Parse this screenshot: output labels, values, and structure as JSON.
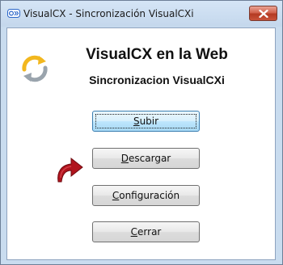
{
  "window": {
    "title": "VisualCX - Sincronización VisualCXi",
    "close_icon": "close-icon"
  },
  "content": {
    "heading": "VisualCX en la Web",
    "subheading": "Sincronizacion VisualCXi",
    "sync_icon": "sync-icon",
    "arrow_icon": "curved-arrow-icon"
  },
  "buttons": [
    {
      "access_key": "S",
      "rest": "ubir",
      "full": "Subir",
      "focused": true
    },
    {
      "access_key": "D",
      "rest": "escargar",
      "full": "Descargar",
      "focused": false
    },
    {
      "access_key": "C",
      "rest": "onfiguración",
      "full": "Configuración",
      "focused": false
    },
    {
      "access_key": "C",
      "rest": "errar",
      "full": "Cerrar",
      "focused": false
    }
  ],
  "colors": {
    "frame": "#c9dcef",
    "close_button": "#c9533a",
    "focused_button": "#bee6fd",
    "sync_icon_yellow": "#f2b71e",
    "sync_icon_gray": "#9aa4ad",
    "arrow_red": "#b0141d"
  }
}
